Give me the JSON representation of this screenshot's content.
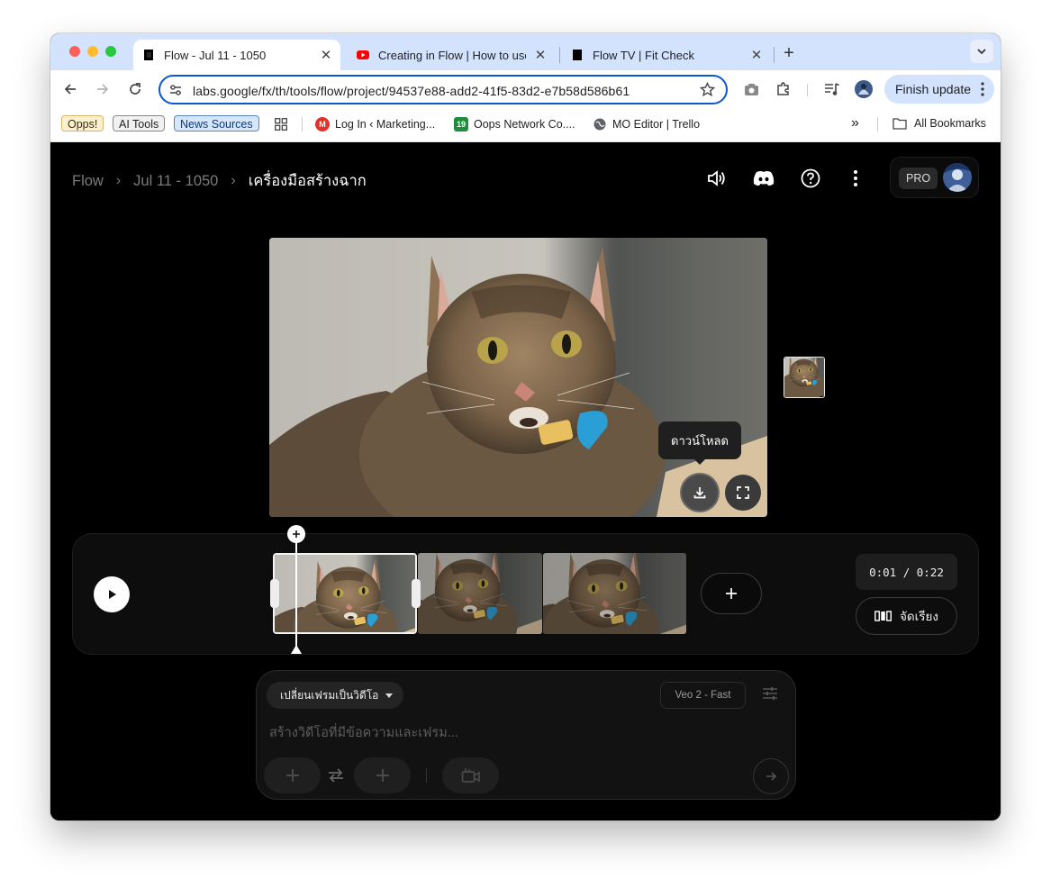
{
  "browser": {
    "tabs": [
      {
        "title": "Flow - Jul 11 - 1050",
        "active": true
      },
      {
        "title": "Creating in Flow | How to use",
        "active": false
      },
      {
        "title": "Flow TV | Fit Check",
        "active": false
      }
    ],
    "url": "labs.google/fx/th/tools/flow/project/94537e88-add2-41f5-83d2-e7b58d586b61",
    "finish_update_label": "Finish update",
    "bookmarks": {
      "chip_opps": "Opps!",
      "chip_ai_tools": "AI Tools",
      "chip_news": "News Sources",
      "item_marketing": "Log In ‹ Marketing...",
      "item_oops": "Oops Network Co....",
      "item_mo_editor": "MO Editor | Trello",
      "overflow": "»",
      "all_bookmarks": "All Bookmarks",
      "calendar_badge": "19"
    },
    "accent_color": "#0b57d0"
  },
  "app": {
    "breadcrumb": {
      "root": "Flow",
      "project": "Jul 11 - 1050",
      "current": "เครื่องมือสร้างฉาก"
    },
    "plan_badge": "PRO",
    "viewer": {
      "tooltip": "ดาวน์โหลด"
    },
    "timeline": {
      "timecode": "0:01 / 0:22",
      "arrange_label": "จัดเรียง",
      "clip_count": 3,
      "selected_clip": 1
    },
    "composer": {
      "mode_label": "เปลี่ยนเฟรมเป็นวิดีโอ",
      "model_label": "Veo 2 - Fast",
      "prompt_placeholder": "สร้างวิดีโอที่มีข้อความและเฟรม..."
    }
  },
  "icons": [
    "back-icon",
    "forward-icon",
    "reload-icon",
    "site-settings-icon",
    "star-icon",
    "camera-icon",
    "extensions-icon",
    "media-icon",
    "profile-icon",
    "kebab-icon",
    "apps-grid-icon",
    "folder-icon",
    "volume-icon",
    "discord-icon",
    "help-icon",
    "more-vert-icon",
    "download-icon",
    "fullscreen-icon",
    "play-icon",
    "plus-icon",
    "swap-icon",
    "camera-video-icon",
    "send-arrow-icon",
    "sliders-icon",
    "dropdown-arrow-icon"
  ]
}
